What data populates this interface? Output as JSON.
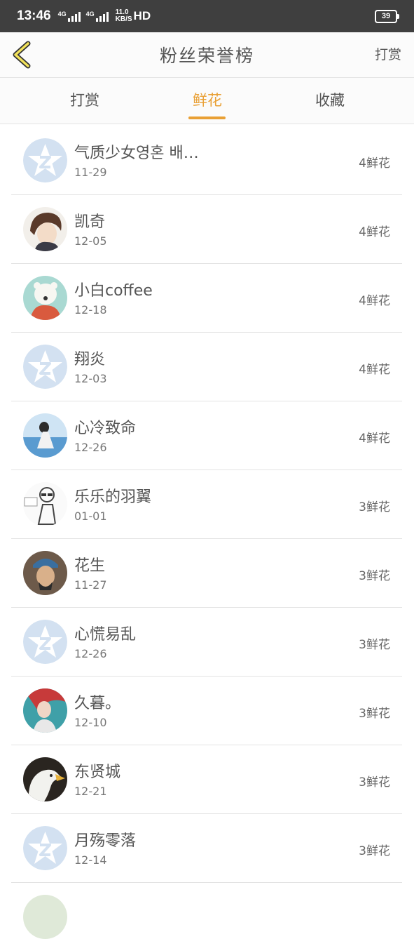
{
  "status_bar": {
    "time": "13:46",
    "network1": "4G",
    "network2": "4G",
    "speed_value": "11.0",
    "speed_unit": "KB/S",
    "hd": "HD",
    "battery": "39"
  },
  "header": {
    "back_icon": "chevron-left-icon",
    "title": "粉丝荣誉榜",
    "action_label": "打赏"
  },
  "tabs": [
    {
      "label": "打赏",
      "active": false
    },
    {
      "label": "鲜花",
      "active": true
    },
    {
      "label": "收藏",
      "active": false
    }
  ],
  "colors": {
    "accent": "#e9a035",
    "divider": "#e3e3e3",
    "default_avatar": "#d3e1f1"
  },
  "fans": [
    {
      "name": "气质少女영혼 배…",
      "date": "11-29",
      "amount": "4鲜花",
      "avatar": "default"
    },
    {
      "name": "凯奇",
      "date": "12-05",
      "amount": "4鲜花",
      "avatar": "photo"
    },
    {
      "name": "小白coffee",
      "date": "12-18",
      "amount": "4鲜花",
      "avatar": "photo"
    },
    {
      "name": "翔炎",
      "date": "12-03",
      "amount": "4鲜花",
      "avatar": "default"
    },
    {
      "name": "心冷致命",
      "date": "12-26",
      "amount": "4鲜花",
      "avatar": "photo"
    },
    {
      "name": "乐乐的羽翼",
      "date": "01-01",
      "amount": "3鲜花",
      "avatar": "photo"
    },
    {
      "name": "花生",
      "date": "11-27",
      "amount": "3鲜花",
      "avatar": "photo"
    },
    {
      "name": "心慌易乱",
      "date": "12-26",
      "amount": "3鲜花",
      "avatar": "default"
    },
    {
      "name": "久暮。",
      "date": "12-10",
      "amount": "3鲜花",
      "avatar": "photo"
    },
    {
      "name": "东贤城",
      "date": "12-21",
      "amount": "3鲜花",
      "avatar": "photo"
    },
    {
      "name": "月殇零落",
      "date": "12-14",
      "amount": "3鲜花",
      "avatar": "default"
    }
  ]
}
